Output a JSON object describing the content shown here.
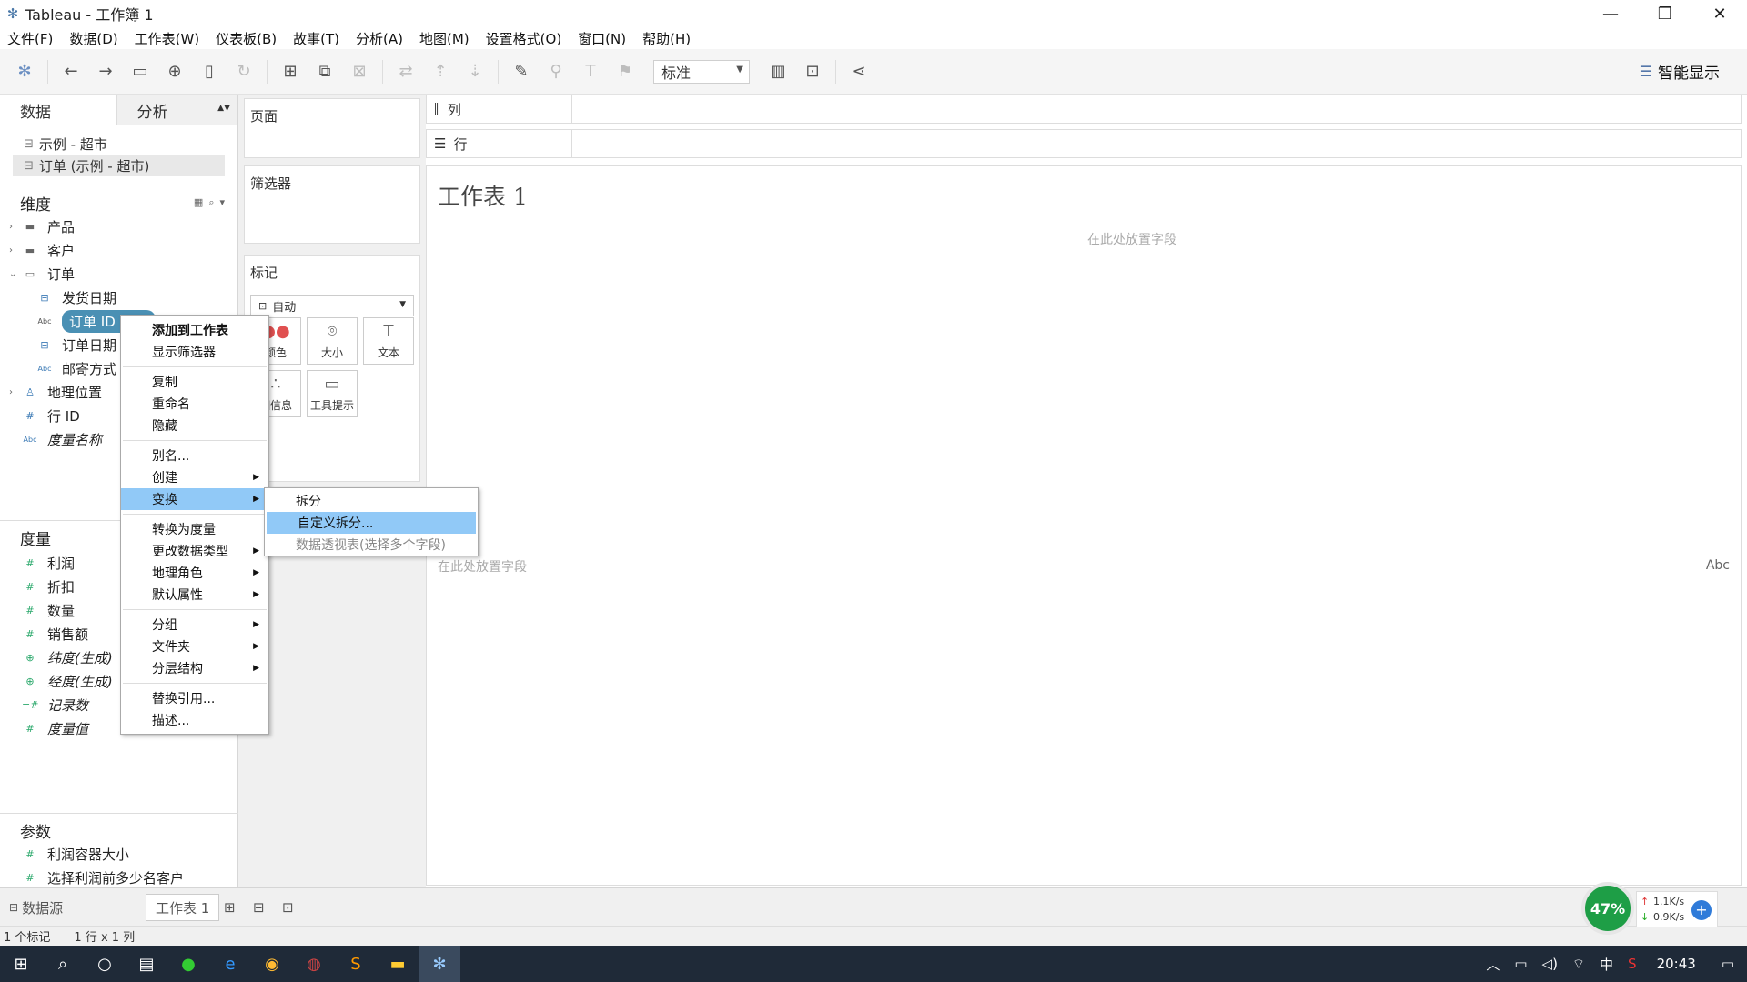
{
  "window": {
    "title": "Tableau - 工作簿 1"
  },
  "menubar": [
    "文件(F)",
    "数据(D)",
    "工作表(W)",
    "仪表板(B)",
    "故事(T)",
    "分析(A)",
    "地图(M)",
    "设置格式(O)",
    "窗口(N)",
    "帮助(H)"
  ],
  "toolbar": {
    "fit_value": "标准",
    "show_me": "智能显示"
  },
  "left": {
    "tab_data": "数据",
    "tab_analysis": "分析",
    "datasources": [
      "示例 - 超市",
      "订单 (示例 - 超市)"
    ],
    "dimensions_title": "维度",
    "dimensions": [
      "产品",
      "客户",
      "订单",
      "发货日期",
      "订单 ID",
      "订单日期",
      "邮寄方式",
      "地理位置",
      "行 ID",
      "度量名称"
    ],
    "measures_title": "度量",
    "measures": [
      "利润",
      "折扣",
      "数量",
      "销售额",
      "纬度(生成)",
      "经度(生成)",
      "记录数",
      "度量值"
    ],
    "params_title": "参数",
    "params": [
      "利润容器大小",
      "选择利润前多少名客户"
    ]
  },
  "cards": {
    "pages": "页面",
    "filters": "筛选器",
    "marks": "标记",
    "marks_type": "自动",
    "color": "颜色",
    "size": "大小",
    "text": "文本",
    "detail": "细信息",
    "tooltip": "工具提示"
  },
  "shelves": {
    "columns": "列",
    "rows": "行"
  },
  "view": {
    "title": "工作表 1",
    "drop_top": "在此处放置字段",
    "drop_left": "在此处放置字段",
    "abc": "Abc"
  },
  "context_menu": [
    "添加到工作表",
    "显示筛选器",
    "复制",
    "重命名",
    "隐藏",
    "别名...",
    "创建",
    "变换",
    "转换为度量",
    "更改数据类型",
    "地理角色",
    "默认属性",
    "分组",
    "文件夹",
    "分层结构",
    "替换引用...",
    "描述..."
  ],
  "submenu": [
    "拆分",
    "自定义拆分...",
    "数据透视表(选择多个字段)"
  ],
  "bottom": {
    "datasource": "数据源",
    "sheet": "工作表 1"
  },
  "status": {
    "marks": "1 个标记",
    "dims": "1 行 x 1 列"
  },
  "widget": {
    "percent": "47%",
    "up": "1.1K/s",
    "down": "0.9K/s"
  },
  "taskbar": {
    "time": "20:43",
    "lang": "中"
  }
}
